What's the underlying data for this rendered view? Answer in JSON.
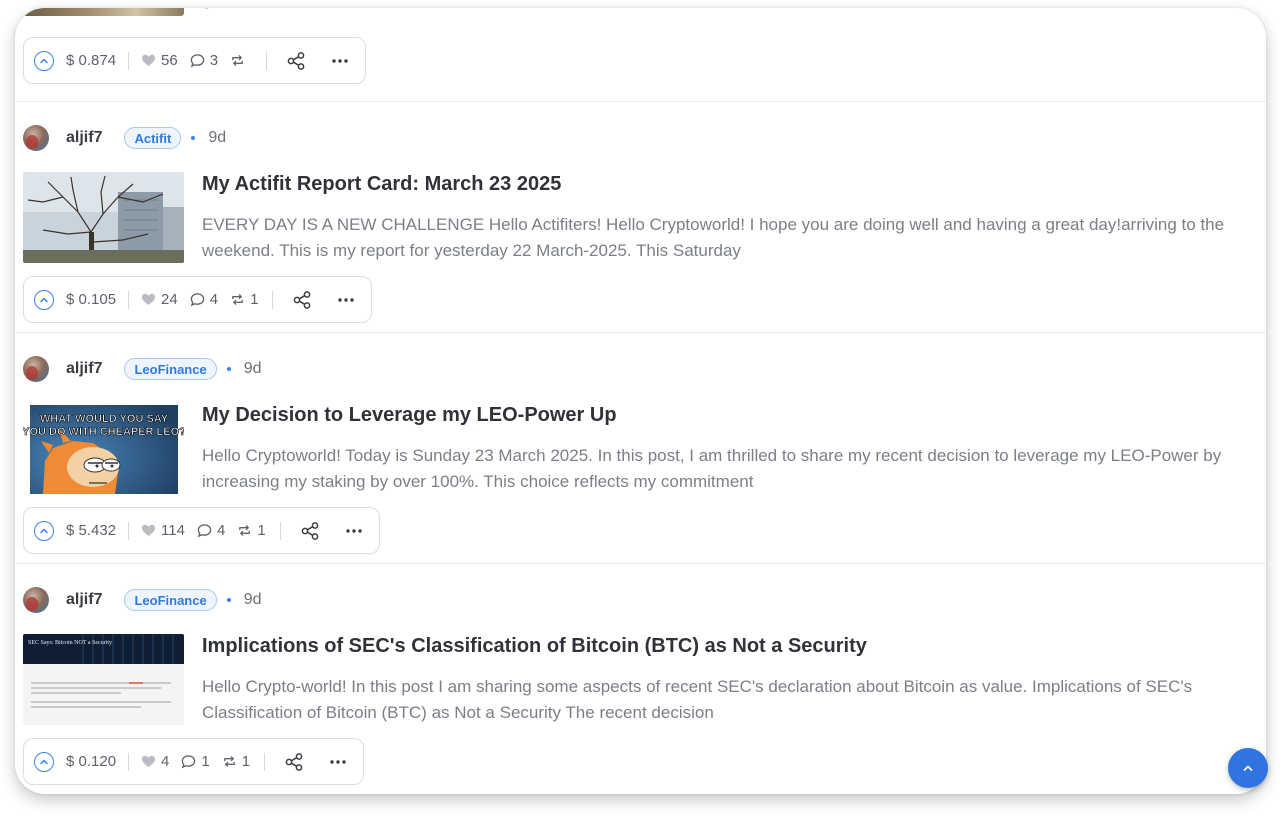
{
  "top_post": {
    "excerpt_fragment": "g",
    "payout": "$ 0.874",
    "likes": "56",
    "comments": "3",
    "reblogs": ""
  },
  "posts": [
    {
      "author": "aljif7",
      "community": "Actifit",
      "age": "9d",
      "title": "My Actifit Report Card: March 23 2025",
      "excerpt": "EVERY DAY IS A NEW CHALLENGE Hello Actifiters! Hello Cryptoworld! I hope you are doing well and having a great day!arriving to the weekend. This is my report for yesterday 22 March-2025. This Saturday",
      "payout": "$ 0.105",
      "likes": "24",
      "comments": "4",
      "reblogs": "1"
    },
    {
      "author": "aljif7",
      "community": "LeoFinance",
      "age": "9d",
      "title": "My Decision to Leverage my LEO-Power Up",
      "excerpt": "Hello Cryptoworld! Today is Sunday 23 March 2025. In this post, I am thrilled to share my recent decision to leverage my LEO-Power by increasing my staking by over 100%. This choice reflects my commitment",
      "thumb_caption_line1": "WHAT WOULD YOU SAY",
      "thumb_caption_line2": "YOU DO WITH CHEAPER LEO?",
      "payout": "$ 5.432",
      "likes": "114",
      "comments": "4",
      "reblogs": "1"
    },
    {
      "author": "aljif7",
      "community": "LeoFinance",
      "age": "9d",
      "title": "Implications of SEC's Classification of Bitcoin (BTC) as Not a Security",
      "excerpt": "Hello Crypto-world! In this post I am sharing some aspects of recent SEC's declaration about Bitcoin as value. Implications of SEC's Classification of Bitcoin (BTC) as Not a Security The recent decision",
      "thumb_heading": "SEC Says: Bitcoin NOT a Security",
      "payout": "$ 0.120",
      "likes": "4",
      "comments": "1",
      "reblogs": "1"
    }
  ],
  "colors": {
    "accent": "#3b82f6",
    "badge_bg": "#eef5fd",
    "badge_text": "#2f7be0",
    "scroll_button": "#2f74e0"
  },
  "icons": [
    "upvote-icon",
    "heart-icon",
    "comment-icon",
    "reblog-icon",
    "share-icon",
    "more-icon",
    "chevron-up-icon"
  ]
}
